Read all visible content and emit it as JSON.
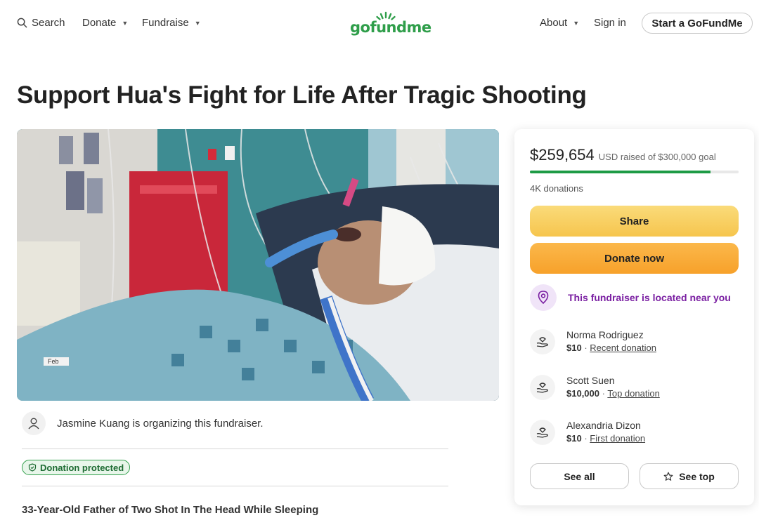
{
  "nav": {
    "search_label": "Search",
    "donate_label": "Donate",
    "fundraise_label": "Fundraise",
    "logo_text": "gofundme",
    "about_label": "About",
    "signin_label": "Sign in",
    "start_label": "Start a GoFundMe"
  },
  "campaign": {
    "title": "Support Hua's Fight for Life After Tragic Shooting",
    "organizer_text": "Jasmine Kuang is organizing this fundraiser.",
    "protected_label": "Donation protected",
    "story_heading": "33-Year-Old Father of Two Shot In The Head While Sleeping",
    "photo_label": "Feb"
  },
  "donation_card": {
    "raised_amount": "$259,654",
    "raised_goal_text": "USD raised of $300,000 goal",
    "progress_fraction": 0.866,
    "donation_count": "4K donations",
    "share_label": "Share",
    "donate_label": "Donate now",
    "near_text": "This fundraiser is located near you",
    "donors": [
      {
        "name": "Norma Rodriguez",
        "amount": "$10",
        "tag": "Recent donation"
      },
      {
        "name": "Scott Suen",
        "amount": "$10,000",
        "tag": "Top donation"
      },
      {
        "name": "Alexandria Dizon",
        "amount": "$10",
        "tag": "First donation"
      }
    ],
    "see_all_label": "See all",
    "see_top_label": "See top"
  },
  "colors": {
    "brand_green": "#2f9e4a",
    "progress_green": "#1d9b45",
    "share_yellow": "#f6c54d",
    "donate_orange": "#f7a12a",
    "near_purple": "#7a1fa2"
  }
}
